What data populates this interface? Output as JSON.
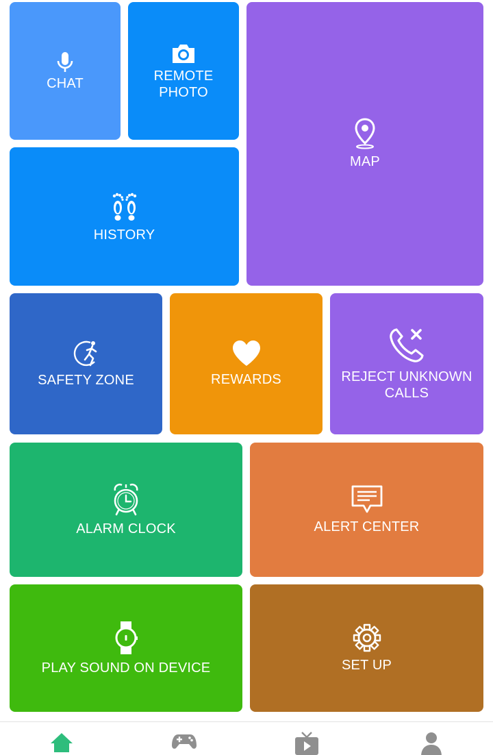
{
  "colors": {
    "chat": "#4a98fb",
    "remote_photo": "#0a8cf9",
    "map": "#9563e8",
    "history": "#0a8cf9",
    "safety_zone": "#2f67c8",
    "rewards": "#f0950a",
    "reject_unknown_calls": "#9563e8",
    "alarm_clock": "#1db56e",
    "alert_center": "#e27c40",
    "play_sound": "#3fba0e",
    "set_up": "#b06f24",
    "nav_active": "#2ebd7c",
    "nav_inactive": "#8f8f8f"
  },
  "tiles": {
    "chat": {
      "label": "CHAT",
      "icon": "microphone-icon"
    },
    "remote_photo": {
      "label": "REMOTE PHOTO",
      "icon": "camera-icon"
    },
    "map": {
      "label": "MAP",
      "icon": "map-pin-icon"
    },
    "history": {
      "label": "HISTORY",
      "icon": "footprints-icon"
    },
    "safety_zone": {
      "label": "SAFETY ZONE",
      "icon": "running-person-circle-icon"
    },
    "rewards": {
      "label": "REWARDS",
      "icon": "heart-icon"
    },
    "reject_unknown_calls": {
      "label": "REJECT UNKNOWN\nCALLS",
      "icon": "phone-reject-icon"
    },
    "alarm_clock": {
      "label": "ALARM CLOCK",
      "icon": "alarm-clock-icon"
    },
    "alert_center": {
      "label": "ALERT CENTER",
      "icon": "message-icon"
    },
    "play_sound": {
      "label": "PLAY SOUND ON DEVICE",
      "icon": "watch-icon"
    },
    "set_up": {
      "label": "SET UP",
      "icon": "gear-icon"
    }
  },
  "nav": {
    "items": [
      {
        "icon": "home-icon",
        "active": true
      },
      {
        "icon": "gamepad-icon",
        "active": false
      },
      {
        "icon": "tv-icon",
        "active": false
      },
      {
        "icon": "person-icon",
        "active": false
      }
    ]
  }
}
